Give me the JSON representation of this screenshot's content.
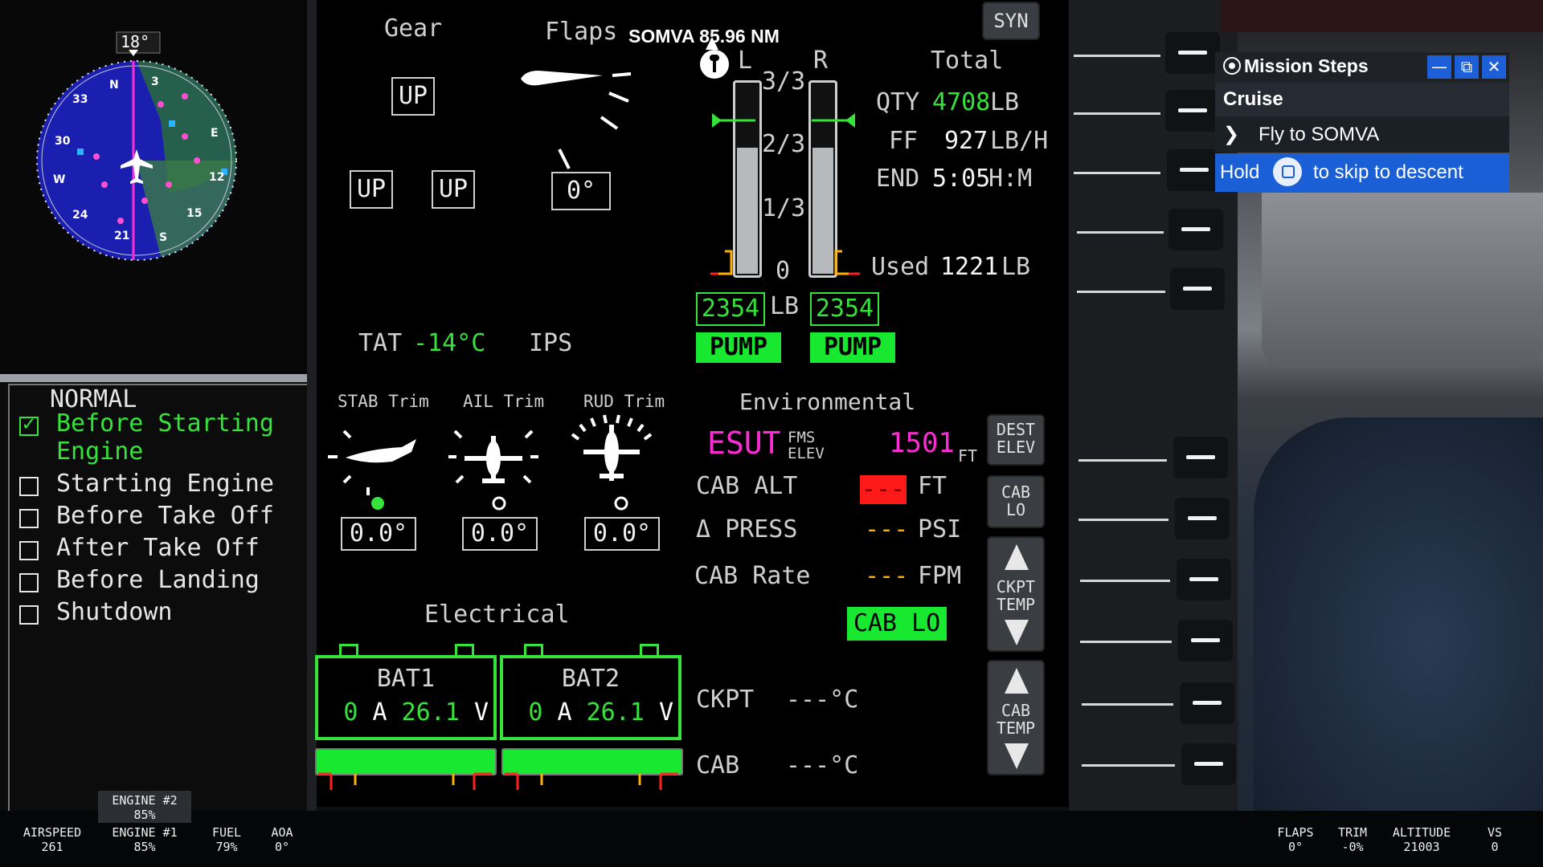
{
  "map": {
    "heading": "18°",
    "cardinal": [
      "N",
      "3",
      "E",
      "12",
      "15",
      "S",
      "21",
      "24",
      "W",
      "30",
      "33"
    ]
  },
  "checklist": {
    "title": "NORMAL",
    "items": [
      {
        "label": "Before Starting",
        "label2": "Engine",
        "done": true
      },
      {
        "label": "Starting Engine",
        "done": false
      },
      {
        "label": "Before Take Off",
        "done": false
      },
      {
        "label": "After Take Off",
        "done": false
      },
      {
        "label": "Before Landing",
        "done": false
      },
      {
        "label": "Shutdown",
        "done": false
      }
    ]
  },
  "waypoint": {
    "text": "SOMVA 85.96 NM"
  },
  "syn_button": "SYN",
  "gear": {
    "title": "Gear",
    "nose": "UP",
    "left": "UP",
    "right": "UP"
  },
  "flaps": {
    "title": "Flaps",
    "value": "0°"
  },
  "fuel": {
    "left_label": "L",
    "right_label": "R",
    "scale": [
      "3/3",
      "2/3",
      "1/3",
      "0"
    ],
    "left_qty": "2354",
    "right_qty": "2354",
    "unit": "LB",
    "left_level": 0.67,
    "right_level": 0.67,
    "pump_label": "PUMP",
    "total_title": "Total",
    "qty_label": "QTY",
    "qty_value": "4708",
    "qty_unit": "LB",
    "ff_label": "FF",
    "ff_value": "927",
    "ff_unit": "LB/H",
    "end_label": "END",
    "end_value": "5:05",
    "end_unit": "H:M",
    "used_label": "Used",
    "used_value": "1221",
    "used_unit": "LB"
  },
  "tat": {
    "label": "TAT",
    "value": "-14°C",
    "ips": "IPS"
  },
  "trim": {
    "stab_label": "STAB Trim",
    "stab_value": "0.0°",
    "ail_label": "AIL Trim",
    "ail_value": "0.0°",
    "rud_label": "RUD Trim",
    "rud_value": "0.0°"
  },
  "environmental": {
    "title": "Environmental",
    "dest": "ESUT",
    "fms_elev": "FMS\nELEV",
    "elev_value": "1501",
    "elev_unit": "FT",
    "cab_alt_label": "CAB ALT",
    "cab_alt_value": "---",
    "cab_alt_unit": "FT",
    "dpress_label": "Δ PRESS",
    "dpress_value": "---",
    "dpress_unit": "PSI",
    "cab_rate_label": "CAB Rate",
    "cab_rate_value": "---",
    "cab_rate_unit": "FPM",
    "cab_lo": "CAB LO",
    "ckpt_label": "CKPT",
    "ckpt_value": "---°C",
    "cab_label": "CAB",
    "cab_value": "---°C"
  },
  "softkeys": {
    "dest_elev": "DEST\nELEV",
    "cab_lo": "CAB\nLO",
    "ckpt_temp": "CKPT\nTEMP",
    "cab_temp": "CAB\nTEMP"
  },
  "electrical": {
    "title": "Electrical",
    "bat1": {
      "name": "BAT1",
      "amps": "0",
      "amp_unit": "A",
      "volts": "26.1",
      "volt_unit": "V"
    },
    "bat2": {
      "name": "BAT2",
      "amps": "0",
      "amp_unit": "A",
      "volts": "26.1",
      "volt_unit": "V"
    }
  },
  "mission": {
    "title": "Mission Steps",
    "phase": "Cruise",
    "step": "Fly to SOMVA",
    "hold_prefix": "Hold",
    "hold_suffix": "to skip to descent"
  },
  "telemetry": [
    {
      "label": "AIRSPEED",
      "value": "261"
    },
    {
      "label": "ENGINE #1",
      "value": "85%"
    },
    {
      "label": "ENGINE #2",
      "value": "85%"
    },
    {
      "label": "FUEL",
      "value": "79%"
    },
    {
      "label": "AOA",
      "value": "0°"
    },
    {
      "label": "FLAPS",
      "value": "0°"
    },
    {
      "label": "TRIM",
      "value": "-0%"
    },
    {
      "label": "ALTITUDE",
      "value": "21003"
    },
    {
      "label": "VS",
      "value": "0"
    }
  ],
  "colors": {
    "green": "#35e33b",
    "magenta": "#ff2bd6",
    "pump": "#18e830",
    "mission_blue": "#1b5fd6"
  }
}
